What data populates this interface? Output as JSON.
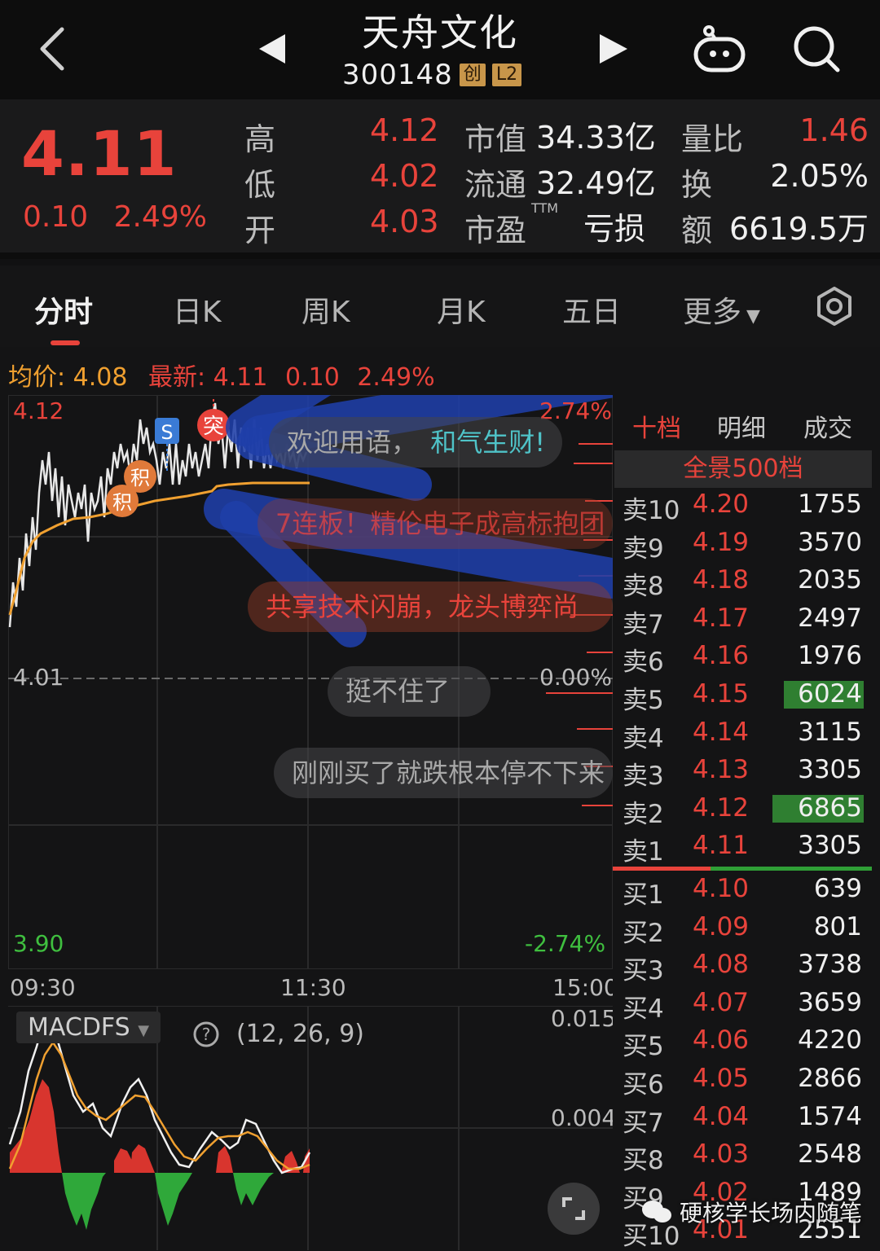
{
  "header": {
    "title": "天舟文化",
    "code": "300148",
    "badges": [
      "创",
      "L2"
    ]
  },
  "quote": {
    "price": "4.11",
    "change": "0.10",
    "change_pct": "2.49%",
    "high_label": "高",
    "high": "4.12",
    "low_label": "低",
    "low": "4.02",
    "open_label": "开",
    "open": "4.03",
    "mktcap_label": "市值",
    "mktcap": "34.33亿",
    "float_label": "流通",
    "float": "32.49亿",
    "pe_label": "市盈",
    "pe_sup": "TTM",
    "pe": "亏损",
    "volratio_label": "量比",
    "volratio": "1.46",
    "turnover_label": "换",
    "turnover": "2.05%",
    "amount_label": "额",
    "amount": "6619.5万"
  },
  "tabs": [
    {
      "label": "分时",
      "active": true
    },
    {
      "label": "日K"
    },
    {
      "label": "周K"
    },
    {
      "label": "月K"
    },
    {
      "label": "五日"
    },
    {
      "label": "更多"
    }
  ],
  "chart_info": {
    "avg_label": "均价:",
    "avg_value": "4.08",
    "latest_label": "最新:",
    "latest_value": "4.11",
    "latest_change": "0.10",
    "latest_pct": "2.49%"
  },
  "chart_axes": {
    "y_top": "4.12",
    "y_mid": "4.01",
    "y_bottom": "3.90",
    "pct_top": "2.74%",
    "pct_mid": "0.00%",
    "pct_bottom": "-2.74%",
    "x_start": "09:30",
    "x_mid": "11:30",
    "x_end": "15:00"
  },
  "markers": {
    "s": "S",
    "tu": "突",
    "ji1": "积",
    "ji2": "积",
    "tu2": "突"
  },
  "macd": {
    "label": "MACDFS",
    "params": "(12, 26, 9)",
    "y_top": "0.015",
    "y_mid": "0.004"
  },
  "danmaku": [
    "欢迎用语，",
    "和气生财!",
    "7连板！精伦电子成高标抱团",
    "共享技术闪崩，龙头博弈尚",
    "挺不住了",
    "刚刚买了就跌根本停不下来"
  ],
  "book": {
    "tabs": [
      "十档",
      "明细",
      "成交"
    ],
    "banner": "全景500档",
    "asks": [
      {
        "label": "卖10",
        "price": "4.20",
        "vol": "1755"
      },
      {
        "label": "卖9",
        "price": "4.19",
        "vol": "3570"
      },
      {
        "label": "卖8",
        "price": "4.18",
        "vol": "2035"
      },
      {
        "label": "卖7",
        "price": "4.17",
        "vol": "2497"
      },
      {
        "label": "卖6",
        "price": "4.16",
        "vol": "1976"
      },
      {
        "label": "卖5",
        "price": "4.15",
        "vol": "6024"
      },
      {
        "label": "卖4",
        "price": "4.14",
        "vol": "3115"
      },
      {
        "label": "卖3",
        "price": "4.13",
        "vol": "3305"
      },
      {
        "label": "卖2",
        "price": "4.12",
        "vol": "6865"
      },
      {
        "label": "卖1",
        "price": "4.11",
        "vol": "3305"
      }
    ],
    "bids": [
      {
        "label": "买1",
        "price": "4.10",
        "vol": "639"
      },
      {
        "label": "买2",
        "price": "4.09",
        "vol": "801"
      },
      {
        "label": "买3",
        "price": "4.08",
        "vol": "3738"
      },
      {
        "label": "买4",
        "price": "4.07",
        "vol": "3659"
      },
      {
        "label": "买5",
        "price": "4.06",
        "vol": "4220"
      },
      {
        "label": "买6",
        "price": "4.05",
        "vol": "2866"
      },
      {
        "label": "买7",
        "price": "4.04",
        "vol": "1574"
      },
      {
        "label": "买8",
        "price": "4.03",
        "vol": "2548"
      },
      {
        "label": "买9",
        "price": "4.02",
        "vol": "1489"
      },
      {
        "label": "买10",
        "price": "4.01",
        "vol": "2551"
      }
    ]
  },
  "watermark": "硬核学长场内随笔",
  "colors": {
    "up": "#e8433b",
    "down": "#3fbf3f",
    "avg": "#f0a030",
    "bg": "#141415"
  }
}
